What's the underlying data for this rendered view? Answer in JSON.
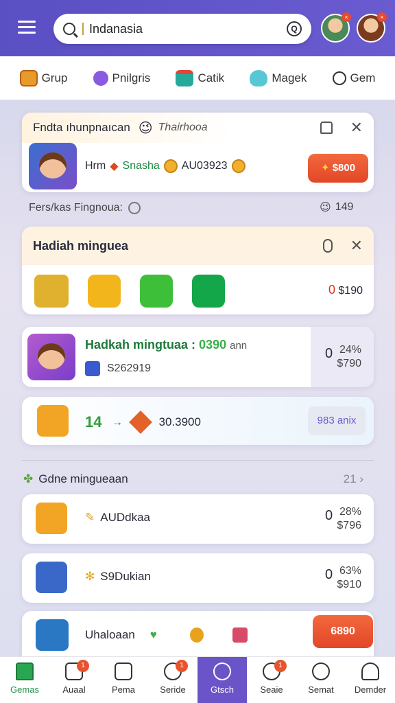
{
  "header": {
    "search_value": "Indanasia",
    "mic_glyph": "Q"
  },
  "tabs": [
    {
      "label": "Grup",
      "icon": "gift-icon"
    },
    {
      "label": "Pnilgris",
      "icon": "purple-circle-icon"
    },
    {
      "label": "Catik",
      "icon": "gift-box-icon"
    },
    {
      "label": "Magek",
      "icon": "teal-heart-icon"
    },
    {
      "label": "Gem",
      "icon": "ring-icon"
    }
  ],
  "promo": {
    "title": "Fndta ıhunpnaıcan",
    "subtitle": "Thairhooa",
    "line_name": "Hrm",
    "line_game": "Snasha",
    "line_amount": "AU03923",
    "button": "$800"
  },
  "info_row": {
    "label": "Fers/kas Fingnoua:",
    "count": "149"
  },
  "weekly": {
    "title": "Hadiah minguea",
    "price_zero": "0",
    "price": "$190"
  },
  "card2": {
    "title": "Hadkah mingtuaa :",
    "highlight": "0390",
    "unit": "ann",
    "sub": "S262919",
    "price_zero": "0",
    "pct": "24%",
    "price": "$790"
  },
  "card3": {
    "level": "14",
    "arrow": "→",
    "amount": "30.3900",
    "button": "983 anix"
  },
  "section": {
    "title": "Gdne mingueaan",
    "count": "21"
  },
  "list": [
    {
      "name": "AUDdkaa",
      "zero": "0",
      "pct": "28%",
      "price": "$796"
    },
    {
      "name": "S9Dukian",
      "zero": "0",
      "pct": "63%",
      "price": "$910"
    }
  ],
  "last_item": {
    "name": "Uhaloaan",
    "button": "6890"
  },
  "bottom_nav": [
    {
      "label": "Gemas",
      "badge": ""
    },
    {
      "label": "Auaal",
      "badge": "1"
    },
    {
      "label": "Pema",
      "badge": ""
    },
    {
      "label": "Seride",
      "badge": "1"
    },
    {
      "label": "Gtsch",
      "badge": ""
    },
    {
      "label": "Seaie",
      "badge": "1"
    },
    {
      "label": "Semat",
      "badge": ""
    },
    {
      "label": "Demder",
      "badge": ""
    }
  ],
  "colors": {
    "header": "#5b4fc4",
    "accent_red": "#e24727",
    "accent_green": "#26904a"
  }
}
